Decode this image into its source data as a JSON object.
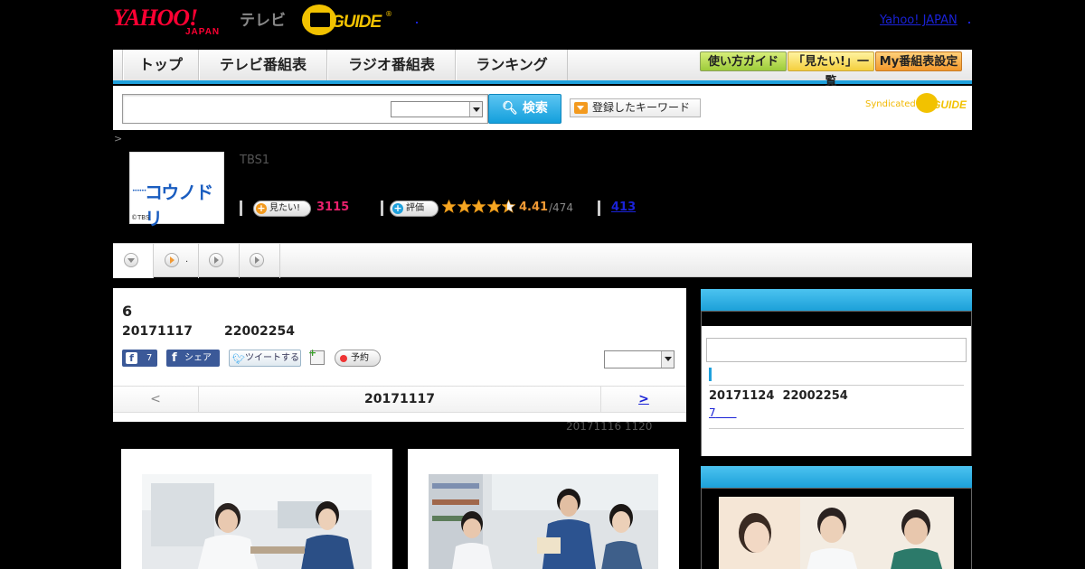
{
  "header": {
    "logo_text": "YAHOO!",
    "logo_sub": "JAPAN",
    "tv_label": "テレビ",
    "gguide_text": "GUIDE",
    "gguide_mark": "®",
    "yahoo_link": "Yahoo! JAPAN"
  },
  "nav": {
    "tabs": [
      "トップ",
      "テレビ番組表",
      "ラジオ番組表",
      "ランキング"
    ],
    "buttons": [
      "使い方ガイド",
      "「見たい!」一覧",
      "My番組表設定"
    ]
  },
  "search": {
    "input_value": "",
    "select_value": "",
    "button_label": "検索",
    "keyword_button": "登録したキーワード",
    "syndicated_label": "Syndicated",
    "syndicated_logo": "GUIDE"
  },
  "breadcrumb": ">",
  "program": {
    "thumbnail_title": "コウノドリ",
    "thumbnail_credit": "©TBS",
    "channel": "TBS1",
    "want_label": "見たい!",
    "want_count": "3115",
    "rating_label": "評価",
    "rating_stars": 4.41,
    "rating_value": "4.41",
    "rating_count": "/474",
    "review_count": "413"
  },
  "tabs": [
    "",
    ".",
    "",
    ""
  ],
  "episode": {
    "title": "6",
    "date": "20171117",
    "time": "22002254",
    "share": {
      "fb_count": "7",
      "fb_share": "シェア",
      "tweet": "ツイートする",
      "reserve": "予約"
    },
    "select_value": "",
    "pager": {
      "prev": "<",
      "current": "20171117",
      "next": ">"
    },
    "updated": "20171116  1120"
  },
  "sidebar": {
    "box1": {
      "next_date": "20171124",
      "next_time": "22002254",
      "next_link": "7"
    }
  },
  "colors": {
    "accent_blue": "#1ea0dc",
    "yahoo_red": "#ff0033",
    "gguide_yellow": "#f2c200",
    "want_pink": "#e9206c",
    "rating_orange": "#f19a35",
    "link_blue": "#1a22d6"
  }
}
